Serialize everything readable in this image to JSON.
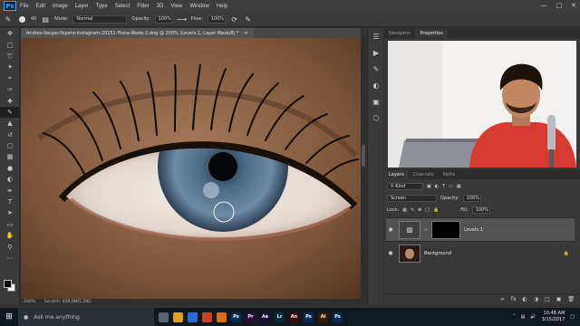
{
  "menubar": {
    "logo": "Ps",
    "items": [
      "File",
      "Edit",
      "Image",
      "Layer",
      "Type",
      "Select",
      "Filter",
      "3D",
      "View",
      "Window",
      "Help"
    ]
  },
  "options": {
    "brush_size": "40",
    "mode_label": "Mode:",
    "mode_value": "Normal",
    "opacity_label": "Opacity:",
    "opacity_value": "100%",
    "flow_label": "Flow:",
    "flow_value": "100%"
  },
  "document": {
    "tab_title": "Andres-Vargas-Yopera-Instagram-20151-Fiona-Wade-2.dng @ 200% (Levels 1, Layer Mask/8) *",
    "zoom": "200%",
    "scratch": "Scratch: 829.0M/5.28G"
  },
  "right_panel": {
    "tabs": [
      "Navigator",
      "Properties"
    ],
    "active_tab": "Properties"
  },
  "layers": {
    "tabs": [
      "Layers",
      "Channels",
      "Paths"
    ],
    "kind_value": "Kind",
    "blend_mode": "Screen",
    "opacity_label": "Opacity:",
    "opacity_value": "100%",
    "lock_label": "Lock:",
    "fill_label": "Fill:",
    "fill_value": "100%",
    "items": [
      {
        "name": "Levels 1"
      },
      {
        "name": "Background"
      }
    ]
  },
  "taskbar": {
    "search_placeholder": "Ask me anything",
    "apps": [
      {
        "label": "",
        "color": "#5a6470"
      },
      {
        "label": "",
        "color": "#e0a020"
      },
      {
        "label": "",
        "color": "#2c6ad8"
      },
      {
        "label": "",
        "color": "#d04020"
      },
      {
        "label": "",
        "color": "#e06c10"
      },
      {
        "label": "Ps",
        "color": "#0a2a55"
      },
      {
        "label": "Pr",
        "color": "#2a0a3a"
      },
      {
        "label": "Ae",
        "color": "#1a0a3a"
      },
      {
        "label": "Lr",
        "color": "#0a2a3a"
      },
      {
        "label": "An",
        "color": "#3a0a0a"
      },
      {
        "label": "Ps",
        "color": "#0a2a55"
      },
      {
        "label": "Ai",
        "color": "#3a1a00"
      },
      {
        "label": "Ps",
        "color": "#0a2a55"
      }
    ],
    "time": "10:48 AM",
    "date": "3/15/2017"
  },
  "colors": {
    "accent": "#31a8ff",
    "taskbar": "#101820"
  }
}
